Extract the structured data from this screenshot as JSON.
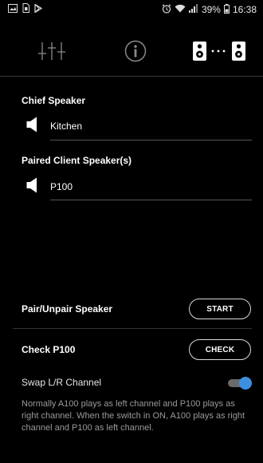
{
  "status_bar": {
    "battery": "39%",
    "time": "16:38",
    "icons": [
      "image-icon",
      "sim-icon",
      "play-store-icon",
      "alarm-icon",
      "wifi-icon",
      "signal-icon",
      "battery-icon"
    ]
  },
  "tabs": [
    {
      "name": "equalizer",
      "icon": "equalizer-icon",
      "active": false
    },
    {
      "name": "info",
      "icon": "info-icon",
      "active": false
    },
    {
      "name": "pairing",
      "icon": "speaker-pair-icon",
      "active": true
    }
  ],
  "chief": {
    "label": "Chief Speaker",
    "speaker_name": "Kitchen",
    "icon": "speaker-icon"
  },
  "paired": {
    "label": "Paired Client Speaker(s)",
    "speaker_name": "P100",
    "icon": "speaker-icon"
  },
  "pair_unpair": {
    "label": "Pair/Unpair Speaker",
    "button_label": "START"
  },
  "check": {
    "label": "Check P100",
    "button_label": "CHECK"
  },
  "swap": {
    "label": "Swap L/R Channel",
    "enabled": true,
    "description": "Normally A100 plays as left channel and P100 plays as right channel. When the switch in ON, A100 plays as right channel and P100 as left channel."
  },
  "colors": {
    "background": "#000000",
    "accent": "#3d8fe0",
    "muted_text": "#9a9a9a"
  }
}
